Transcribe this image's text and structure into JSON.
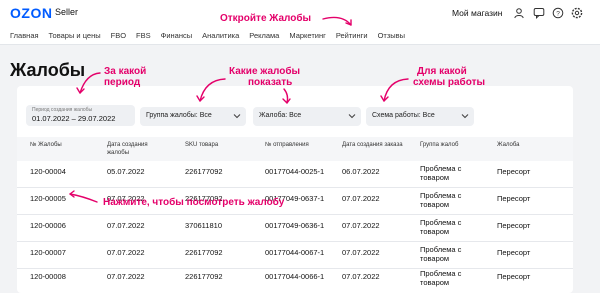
{
  "header": {
    "logo": "OZON",
    "logo_sub": "Seller",
    "shop": "Мой магазин",
    "icons": [
      "user-icon",
      "chat-icon",
      "help-icon",
      "settings-icon"
    ]
  },
  "nav": [
    "Главная",
    "Товары и цены",
    "FBO",
    "FBS",
    "Финансы",
    "Аналитика",
    "Реклама",
    "Маркетинг",
    "Рейтинги",
    "Отзывы"
  ],
  "page": {
    "title": "Жалобы"
  },
  "filters": {
    "period_label": "Период создания жалобы",
    "period_value": "01.07.2022 – 29.07.2022",
    "group": "Группа жалобы: Все",
    "complaint": "Жалоба: Все",
    "scheme": "Схема работы: Все"
  },
  "table": {
    "headers": [
      "№ Жалобы",
      "Дата создания жалобы",
      "SKU товара",
      "№ отправления",
      "Дата создания заказа",
      "Группа жалоб",
      "Жалоба"
    ],
    "rows": [
      [
        "120-00004",
        "05.07.2022",
        "226177092",
        "00177044-0025-1",
        "06.07.2022",
        "Проблема с товаром",
        "Пересорт"
      ],
      [
        "120-00005",
        "07.07.2022",
        "226177092",
        "00177049-0637-1",
        "07.07.2022",
        "Проблема с товаром",
        "Пересорт"
      ],
      [
        "120-00006",
        "07.07.2022",
        "370611810",
        "00177049-0636-1",
        "07.07.2022",
        "Проблема с товаром",
        "Пересорт"
      ],
      [
        "120-00007",
        "07.07.2022",
        "226177092",
        "00177044-0067-1",
        "07.07.2022",
        "Проблема с товаром",
        "Пересорт"
      ],
      [
        "120-00008",
        "07.07.2022",
        "226177092",
        "00177044-0066-1",
        "07.07.2022",
        "Проблема с товаром",
        "Пересорт"
      ]
    ]
  },
  "annotations": {
    "open": "Откройте Жалобы",
    "period": [
      "За какой",
      "период"
    ],
    "which": [
      "Какие жалобы",
      "показать"
    ],
    "scheme": [
      "Для какой",
      "схемы работы"
    ],
    "click": "Нажмите, чтобы посмотреть жалобу"
  },
  "colors": {
    "brand": "#005bff",
    "annotation": "#e4006a",
    "background": "#f2f3f5"
  }
}
